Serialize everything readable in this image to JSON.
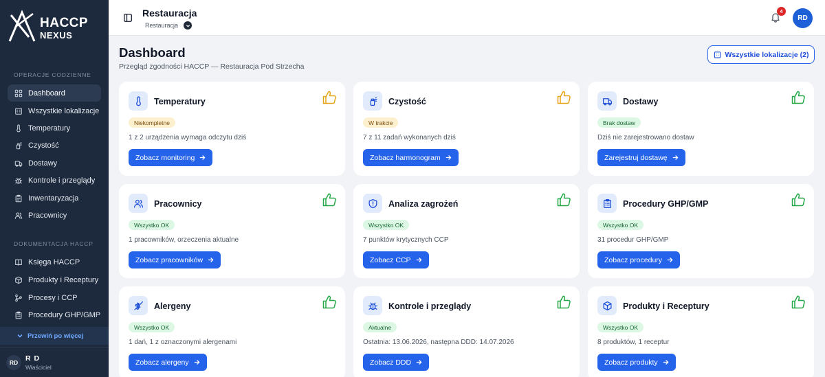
{
  "sidebar": {
    "logo_line1": "HACCP",
    "logo_line2": "NEXUS",
    "section_daily": "OPERACJE CODZIENNE",
    "section_docs": "DOKUMENTACJA HACCP",
    "items": [
      {
        "label": "Dashboard",
        "icon": "grid-icon"
      },
      {
        "label": "Wszystkie lokalizacje",
        "icon": "building-icon"
      },
      {
        "label": "Temperatury",
        "icon": "thermometer-icon"
      },
      {
        "label": "Czystość",
        "icon": "spray-icon"
      },
      {
        "label": "Dostawy",
        "icon": "truck-icon"
      },
      {
        "label": "Kontrole i przeglądy",
        "icon": "bug-icon"
      },
      {
        "label": "Inwentaryzacja",
        "icon": "clipboard-icon"
      },
      {
        "label": "Pracownicy",
        "icon": "users-icon"
      },
      {
        "label": "Księga HACCP",
        "icon": "book-icon"
      },
      {
        "label": "Produkty i Receptury",
        "icon": "box-icon"
      },
      {
        "label": "Procesy i CCP",
        "icon": "flow-icon"
      },
      {
        "label": "Procedury GHP/GMP",
        "icon": "clipboard-list-icon"
      }
    ],
    "more_label": "Przewiń po więcej",
    "user": {
      "initials": "RD",
      "name": "R D",
      "role": "Właściciel"
    }
  },
  "topbar": {
    "title": "Restauracja",
    "subtitle": "Restauracja",
    "notifications": "4",
    "avatar": "RD"
  },
  "main": {
    "title": "Dashboard",
    "subtitle": "Przegląd zgodności HACCP — Restauracja Pod Strzecha",
    "locations_button": "Wszystkie lokalizacje (2)",
    "cards": [
      {
        "title": "Temperatury",
        "icon": "thermometer-icon",
        "badge": "Niekompletne",
        "badge_type": "warn",
        "thumb_color": "#e6a317",
        "desc": "1 z 2 urządzenia wymaga odczytu dziś",
        "action": "Zobacz monitoring"
      },
      {
        "title": "Czystość",
        "icon": "spray-icon",
        "badge": "W trakcie",
        "badge_type": "warn",
        "thumb_color": "#e6a317",
        "desc": "7 z 11 zadań wykonanych dziś",
        "action": "Zobacz harmonogram"
      },
      {
        "title": "Dostawy",
        "icon": "truck-icon",
        "badge": "Brak dostaw",
        "badge_type": "ok",
        "thumb_color": "#22a846",
        "desc": "Dziś nie zarejestrowano dostaw",
        "action": "Zarejestruj dostawę"
      },
      {
        "title": "Pracownicy",
        "icon": "users-icon",
        "badge": "Wszystko OK",
        "badge_type": "ok",
        "thumb_color": "#22a846",
        "desc": "1 pracowników, orzeczenia aktualne",
        "action": "Zobacz pracowników"
      },
      {
        "title": "Analiza zagrożeń",
        "icon": "shield-icon",
        "badge": "Wszystko OK",
        "badge_type": "ok",
        "thumb_color": "#22a846",
        "desc": "7 punktów krytycznych CCP",
        "action": "Zobacz CCP"
      },
      {
        "title": "Procedury GHP/GMP",
        "icon": "clipboard-list-icon",
        "badge": "Wszystko OK",
        "badge_type": "ok",
        "thumb_color": "#22a846",
        "desc": "31 procedur GHP/GMP",
        "action": "Zobacz procedury"
      },
      {
        "title": "Alergeny",
        "icon": "wheat-icon",
        "badge": "Wszystko OK",
        "badge_type": "ok",
        "thumb_color": "#22a846",
        "desc": "1 dań, 1 z oznaczonymi alergenami",
        "action": "Zobacz alergeny"
      },
      {
        "title": "Kontrole i przeglądy",
        "icon": "bug-icon",
        "badge": "Aktualne",
        "badge_type": "ok",
        "thumb_color": "#22a846",
        "desc": "Ostatnia: 13.06.2026, następna DDD: 14.07.2026",
        "action": "Zobacz DDD"
      },
      {
        "title": "Produkty i Receptury",
        "icon": "box-icon",
        "badge": "Wszystko OK",
        "badge_type": "ok",
        "thumb_color": "#22a846",
        "desc": "8 produktów, 1 receptur",
        "action": "Zobacz produkty"
      }
    ]
  }
}
